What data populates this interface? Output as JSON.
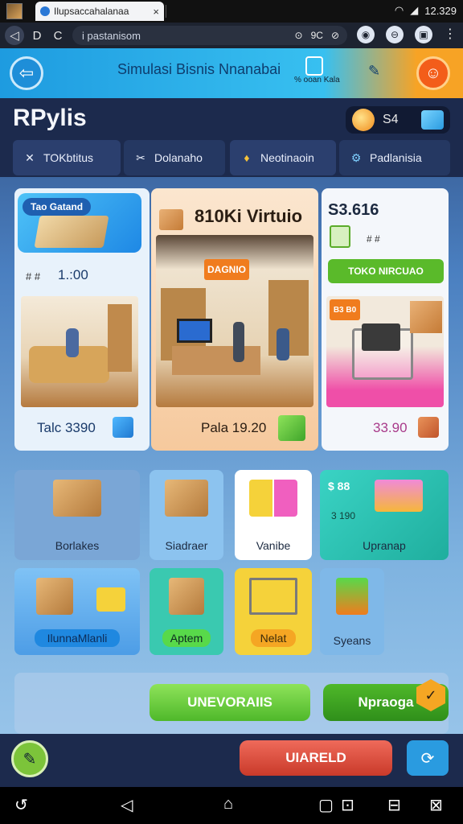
{
  "browser": {
    "tab_title": "Ilupsaccahalanaa",
    "tab_close": "×",
    "status_time": "12.329",
    "url": "i pastanisom",
    "nav_back": "◁",
    "nav_d": "D",
    "nav_reload": "C",
    "url_icons": [
      "⊙",
      "9C",
      "⊘"
    ]
  },
  "header": {
    "title": "Simulasi Bisnis Nnanabai",
    "subtitle": "% ooan Kala"
  },
  "app": {
    "logo": "RPylis",
    "coin_count": "S4"
  },
  "categories": [
    {
      "label": "TOKbtitus",
      "icon": "✕"
    },
    {
      "label": "Dolanaho",
      "icon": "✂"
    },
    {
      "label": "Neotinaoin",
      "icon": "♦"
    },
    {
      "label": "Padlanisia",
      "icon": "⚙"
    }
  ],
  "cards": {
    "left": {
      "badge": "Tao Gatand",
      "price_top": "1.:00",
      "price_top_prefix": "# #",
      "price": "Talc 3390"
    },
    "center": {
      "title": "810Ki Virtuio",
      "sign": "DAGNIO",
      "price": "Pala 19.20"
    },
    "right": {
      "price_title": "S3.616",
      "stars": "# #",
      "button": "TOKO NIRCUAO",
      "tag": "B3 B0",
      "price": "33.90"
    }
  },
  "tiles_row1": [
    {
      "label": "Borlakes"
    },
    {
      "label": "Siadraer"
    },
    {
      "label": "Vanibe"
    },
    {
      "label": "Upranap",
      "top_text": "$ 88",
      "mid_text": "3 190"
    }
  ],
  "tiles_row2": [
    {
      "label": "IlunnaMlanli"
    },
    {
      "label": "Aptem"
    },
    {
      "label": "Nelat"
    },
    {
      "label": "Syeans"
    }
  ],
  "actions": {
    "primary": "UNEVORAIIS",
    "secondary": "Npraoga",
    "danger": "UIARELD"
  },
  "colors": {
    "accent": "#2a9be0",
    "green": "#7cc43a",
    "orange": "#f35d1a",
    "red": "#e2483a"
  }
}
